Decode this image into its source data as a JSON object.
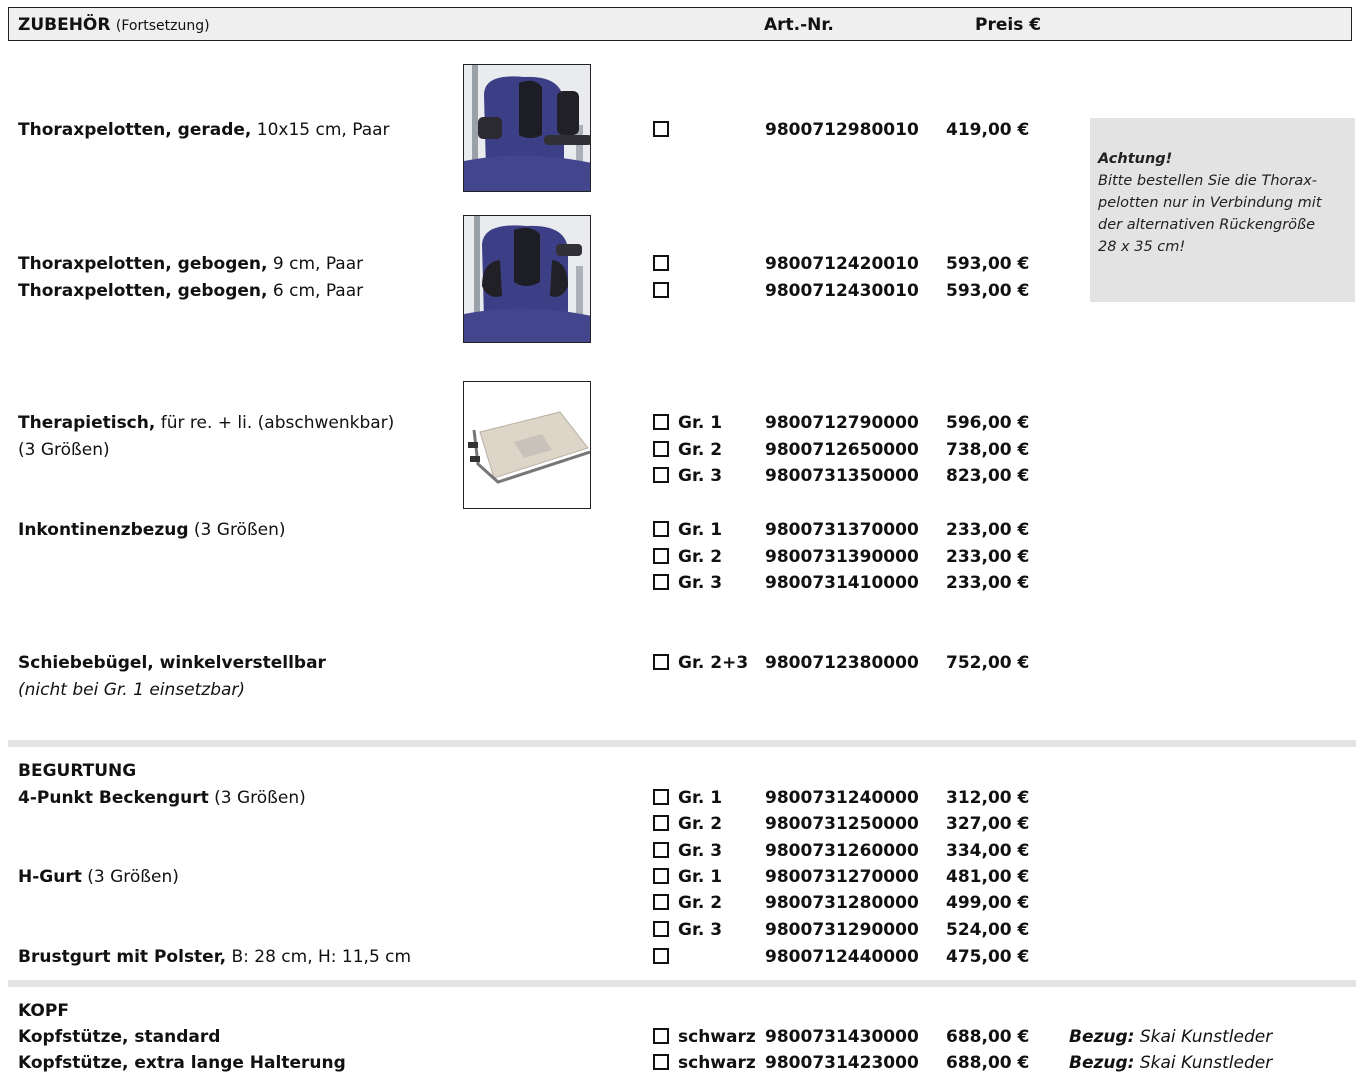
{
  "header": {
    "title": "ZUBEHÖR",
    "subtitle": "(Fortsetzung)",
    "col_art": "Art.-Nr.",
    "col_price": "Preis €"
  },
  "note": {
    "title": "Achtung!",
    "lines": [
      "Bitte bestellen Sie die Thorax-",
      "pelotten nur in Verbindung mit",
      "der alternativen Rückengröße",
      "28 x 35 cm!"
    ]
  },
  "items": {
    "thorax_gerade": {
      "bold": "Thoraxpelotten, gerade,",
      "rest": " 10x15 cm, Paar",
      "art": "9800712980010",
      "price": "419,00 €"
    },
    "thorax_geb9": {
      "bold": "Thoraxpelotten, gebogen,",
      "rest": " 9 cm, Paar",
      "art": "9800712420010",
      "price": "593,00 €"
    },
    "thorax_geb6": {
      "bold": "Thoraxpelotten, gebogen,",
      "rest": " 6 cm,  Paar",
      "art": "9800712430010",
      "price": "593,00 €"
    },
    "therapietisch": {
      "bold": "Therapietisch,",
      "rest": " für re. + li. (abschwenkbar)",
      "line2": "(3 Größen)",
      "rows": [
        {
          "size": "Gr. 1",
          "art": "9800712790000",
          "price": "596,00 €"
        },
        {
          "size": "Gr. 2",
          "art": "9800712650000",
          "price": "738,00 €"
        },
        {
          "size": "Gr. 3",
          "art": "9800731350000",
          "price": "823,00 €"
        }
      ]
    },
    "inkontinenz": {
      "bold": "Inkontinenzbezug",
      "rest": " (3 Größen)",
      "rows": [
        {
          "size": "Gr. 1",
          "art": "9800731370000",
          "price": "233,00 €"
        },
        {
          "size": "Gr. 2",
          "art": "9800731390000",
          "price": "233,00 €"
        },
        {
          "size": "Gr. 3",
          "art": "9800731410000",
          "price": "233,00 €"
        }
      ]
    },
    "schiebe": {
      "bold": "Schiebebügel, winkelverstellbar",
      "line2": "(nicht bei Gr. 1 einsetzbar)",
      "size": "Gr. 2+3",
      "art": "9800712380000",
      "price": "752,00 €"
    }
  },
  "begurtung": {
    "title": "BEGURTUNG",
    "becken": {
      "bold": "4-Punkt Beckengurt",
      "rest": " (3 Größen)",
      "rows": [
        {
          "size": "Gr. 1",
          "art": "9800731240000",
          "price": "312,00 €"
        },
        {
          "size": "Gr. 2",
          "art": "9800731250000",
          "price": "327,00 €"
        },
        {
          "size": "Gr. 3",
          "art": "9800731260000",
          "price": "334,00 €"
        }
      ]
    },
    "hgurt": {
      "bold": "H-Gurt",
      "rest": " (3 Größen)",
      "rows": [
        {
          "size": "Gr. 1",
          "art": "9800731270000",
          "price": "481,00 €"
        },
        {
          "size": "Gr. 2",
          "art": "9800731280000",
          "price": "499,00 €"
        },
        {
          "size": "Gr. 3",
          "art": "9800731290000",
          "price": "524,00 €"
        }
      ]
    },
    "brust": {
      "bold": "Brustgurt mit Polster,",
      "rest": " B: 28 cm, H: 11,5 cm",
      "art": "9800712440000",
      "price": "475,00 €"
    }
  },
  "kopf": {
    "title": "KOPF",
    "standard": {
      "bold": "Kopfstütze, standard",
      "size": "schwarz",
      "art": "9800731430000",
      "price": "688,00 €",
      "bez_label": "Bezug:",
      "bez_val": " Skai Kunstleder"
    },
    "extra": {
      "bold": "Kopfstütze, extra lange Halterung",
      "size": "schwarz",
      "art": "9800731423000",
      "price": "688,00 €",
      "bez_label": "Bezug:",
      "bez_val": " Skai Kunstleder"
    }
  }
}
